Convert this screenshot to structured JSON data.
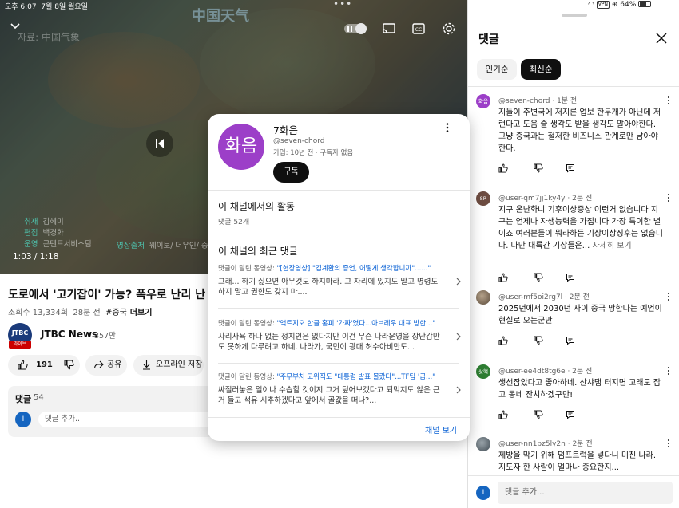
{
  "status_bar": {
    "time": "오후 6:07",
    "date": "7월 8일 월요일",
    "vpn": "VPN",
    "battery": "64%"
  },
  "video": {
    "watermark": "中国天气",
    "topleft_text": "자료: 中国气象",
    "timecode": "1:03 / 1:18",
    "credits": [
      {
        "key": "취재",
        "value": "김혜미"
      },
      {
        "key": "편집",
        "value": "백경화"
      },
      {
        "key": "운영",
        "value": "콘텐트서비스팀"
      }
    ],
    "credit_extra": {
      "key": "영상출처",
      "value": "웨이보/ 더우인/ 중"
    }
  },
  "info": {
    "title": "도로에서 '고기잡이' 가능? 폭우로 난리 난 중국",
    "views": "조회수 13,334회",
    "age": "28분 전",
    "tag": "#중국",
    "more": "더보기",
    "channel_logo": "JTBC",
    "live_badge": "라이브",
    "channel_name": "JTBC News",
    "subscribers": "357만",
    "like_count": "191",
    "share_label": "공유",
    "offline_label": "오프라인 저장",
    "comments_label": "댓글",
    "comments_count": "54",
    "user_initial": "I",
    "add_comment_placeholder": "댓글 추가..."
  },
  "popup": {
    "avatar_text": "화음",
    "name": "7화음",
    "handle": "@seven-chord",
    "joined": "가입: 10년 전 · 구독자 없음",
    "subscribe": "구독",
    "activity_title": "이 채널에서의 활동",
    "activity_sub": "댓글 52개",
    "recent_title": "이 채널의 최근 댓글",
    "items": [
      {
        "prefix": "댓글이 달린 동영상: ",
        "video": "\"[현장영상] \"김계환의 증언, 어떻게 생각합니까\"......\"",
        "text": "그래... 하기 싫으면 아무것도 하지마라. 그 자리에 있지도 말고 명령도 하지 말고 권한도 갖지 마...."
      },
      {
        "prefix": "댓글이 달린 동영상: ",
        "video": "\"액트지오 한글 홈피 '가짜'였다...아브레우 대표 방한...\"",
        "text": "사리사욕 하나 없는 정치인은 없다지만 이건 무슨 나라운영을 장난감만도 못하게 다루려고 하네. 나라가, 국민이 광대 허수아비만도..."
      },
      {
        "prefix": "댓글이 달린 동영상: ",
        "video": "\"주무부처 고위직도 \"대통령 발표 몰랐다\"...TF팀 '급...\"",
        "text": "싸질러놓은 일이나 수습할 것이지 그거 덮어보겠다고 되먹지도 않은 근거 들고 석유 시추하겠다고 앞에서 골값을 떠나?..."
      }
    ],
    "view_channel": "채널 보기"
  },
  "comments_panel": {
    "title": "댓글",
    "chip_popular": "인기순",
    "chip_newest": "최신순",
    "comments": [
      {
        "avatar_text": "화음",
        "avatar_color": "#9c3fc8",
        "author": "@seven-chord",
        "time": "1분 전",
        "text": "지들이 주변국에 저지른 업보 한두개가 아닌데 저런다고 도움 줄 생각도 받을 생각도 말아야한다. 그냥 중국과는 철저한 비즈니스 관계로만 남아야 한다.",
        "more": ""
      },
      {
        "avatar_text": "SR",
        "avatar_color": "#6d4c41",
        "author": "@user-qm7jj1ky4y",
        "time": "2분 전",
        "text": "지구 온난화니 기후이상증상 이런거 없습니다 지구는 언제나 자생능력을 가집니다 가장 특이한 별이죠 여러분들이 뭐라하든 기상이상징후는 없습니다. 다만 대륙간 기상들은...",
        "more": "자세히 보기"
      },
      {
        "avatar_text": "",
        "avatar_color": "#7a6a5a",
        "author": "@user-mf5oi2rg7l",
        "time": "2분 전",
        "text": "2025년에서 2030년 사이 중국 망한다는 예언이 현실로 오는군만",
        "more": ""
      },
      {
        "avatar_text": "삿핵",
        "avatar_color": "#2e7d32",
        "author": "@user-ee4dt8tg6e",
        "time": "2분 전",
        "text": "생선잡았다고 좋아하네. 산샤댐 터지면 고래도 잡고 동네 잔치하겠구만!",
        "more": ""
      },
      {
        "avatar_text": "",
        "avatar_color": "#5b6770",
        "author": "@user-nn1pz5ly2n",
        "time": "2분 전",
        "text": "제방을 막기 위해 덤프트럭을 넣다니 미친 나라. 지도자 한 사람이 얼마나 중요한지...",
        "more": ""
      }
    ],
    "user_initial": "I",
    "add_comment_placeholder": "댓글 추가..."
  }
}
